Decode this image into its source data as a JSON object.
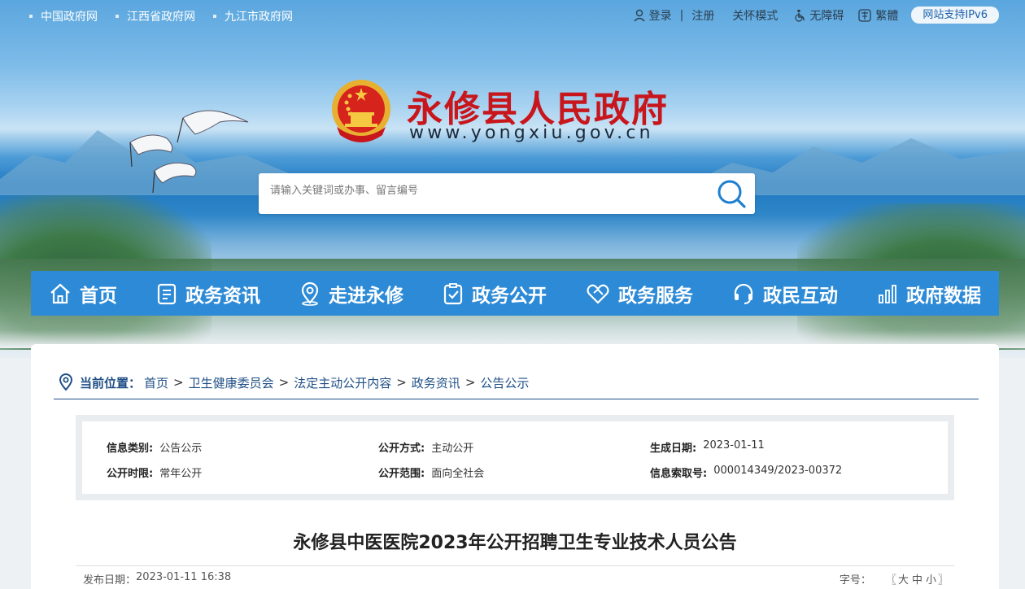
{
  "top": {
    "links": [
      "中国政府网",
      "江西省政府网",
      "九江市政府网"
    ],
    "login": "登录",
    "divider": "|",
    "register": "注册",
    "care_mode": "关怀模式",
    "accessibility": "无障碍",
    "traditional": "繁體",
    "ipv6": "网站支持IPv6"
  },
  "site": {
    "name": "永修县人民政府",
    "url": "www.yongxiu.gov.cn"
  },
  "search": {
    "placeholder": "请输入关键词或办事、留言编号"
  },
  "nav": {
    "items": [
      {
        "label": "首页",
        "icon": "home-icon"
      },
      {
        "label": "政务资讯",
        "icon": "news-icon"
      },
      {
        "label": "走进永修",
        "icon": "location-icon"
      },
      {
        "label": "政务公开",
        "icon": "clipboard-check-icon"
      },
      {
        "label": "政务服务",
        "icon": "handshake-icon"
      },
      {
        "label": "政民互动",
        "icon": "headset-icon"
      },
      {
        "label": "政府数据",
        "icon": "bar-chart-icon"
      }
    ]
  },
  "breadcrumb": {
    "lead": "当前位置：",
    "items": [
      "首页",
      "卫生健康委员会",
      "法定主动公开内容",
      "政务资讯",
      "公告公示"
    ],
    "separator": ">"
  },
  "info": {
    "category_k": "信息类别:",
    "category_v": "公告公示",
    "method_k": "公开方式:",
    "method_v": "主动公开",
    "date_k": "生成日期:",
    "date_v": "2023-01-11",
    "period_k": "公开时限:",
    "period_v": "常年公开",
    "scope_k": "公开范围:",
    "scope_v": "面向全社会",
    "index_k": "信息索取号:",
    "index_v": "000014349/2023-00372"
  },
  "article": {
    "title": "永修县中医医院2023年公开招聘卫生专业技术人员公告",
    "published_label": "发布日期：",
    "published": "2023-01-11 16:38",
    "font_size_label": "字号：",
    "font_open": "〖",
    "font_large": "大",
    "font_medium": "中",
    "font_small": "小",
    "font_close": "〗"
  },
  "colors": {
    "brand_red": "#c8161d",
    "nav_blue": "#2d8ad6",
    "crumb_blue": "#1f4f86"
  }
}
